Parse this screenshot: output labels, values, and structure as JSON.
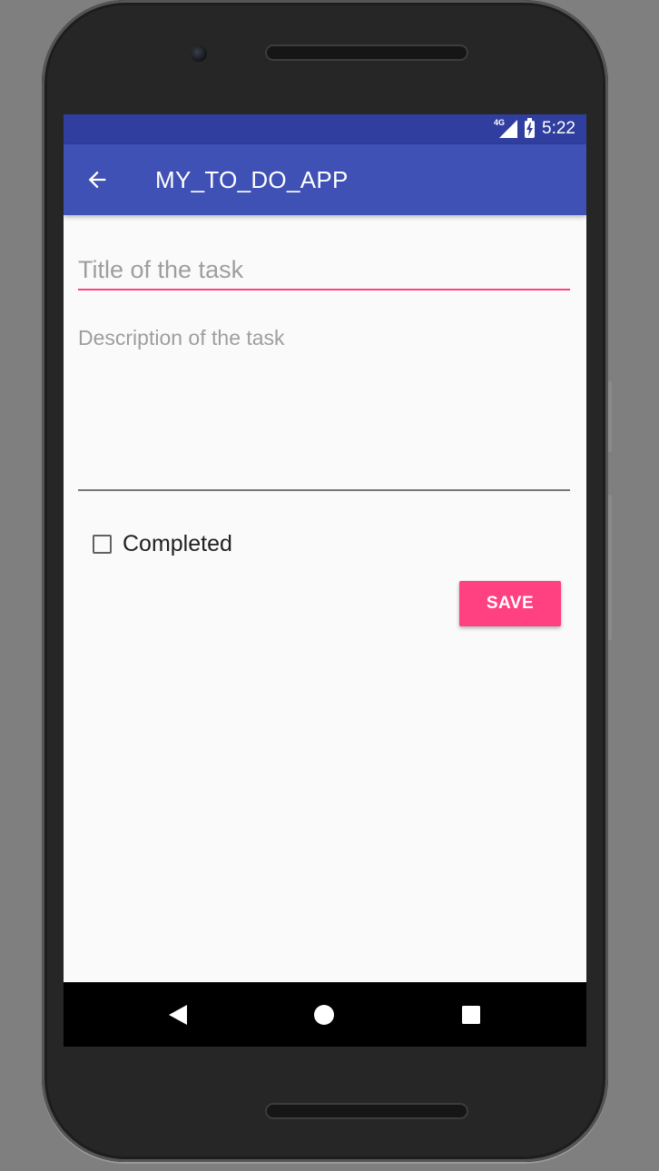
{
  "statusbar": {
    "network": "4G",
    "time": "5:22"
  },
  "appbar": {
    "title": "MY_TO_DO_APP",
    "back_icon": "arrow-back-icon"
  },
  "form": {
    "title_placeholder": "Title of the task",
    "title_value": "",
    "description_placeholder": "Description of the task",
    "description_value": "",
    "completed_label": "Completed",
    "completed_checked": false,
    "save_label": "SAVE"
  },
  "navbar": {
    "back_icon": "nav-back-triangle-icon",
    "home_icon": "nav-home-circle-icon",
    "recent_icon": "nav-recent-square-icon"
  },
  "colors": {
    "primary": "#3f51b5",
    "primary_dark": "#303f9f",
    "accent": "#ff4081",
    "background": "#fafafa"
  }
}
